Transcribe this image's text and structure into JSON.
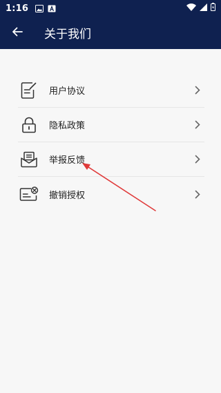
{
  "status_bar": {
    "time": "1:16",
    "icons": [
      "image-icon",
      "text-a-icon",
      "wifi-icon",
      "signal-icon",
      "battery-icon"
    ]
  },
  "app_bar": {
    "title": "关于我们",
    "back_icon": "arrow-left-icon",
    "background": "#0f2150"
  },
  "menu": {
    "items": [
      {
        "label": "用户协议",
        "icon": "document-edit-icon"
      },
      {
        "label": "隐私政策",
        "icon": "lock-icon"
      },
      {
        "label": "举报反馈",
        "icon": "mail-report-icon"
      },
      {
        "label": "撤销授权",
        "icon": "revoke-card-icon"
      }
    ]
  },
  "annotation": {
    "color": "#e03a3a",
    "points_to": "举报反馈"
  }
}
